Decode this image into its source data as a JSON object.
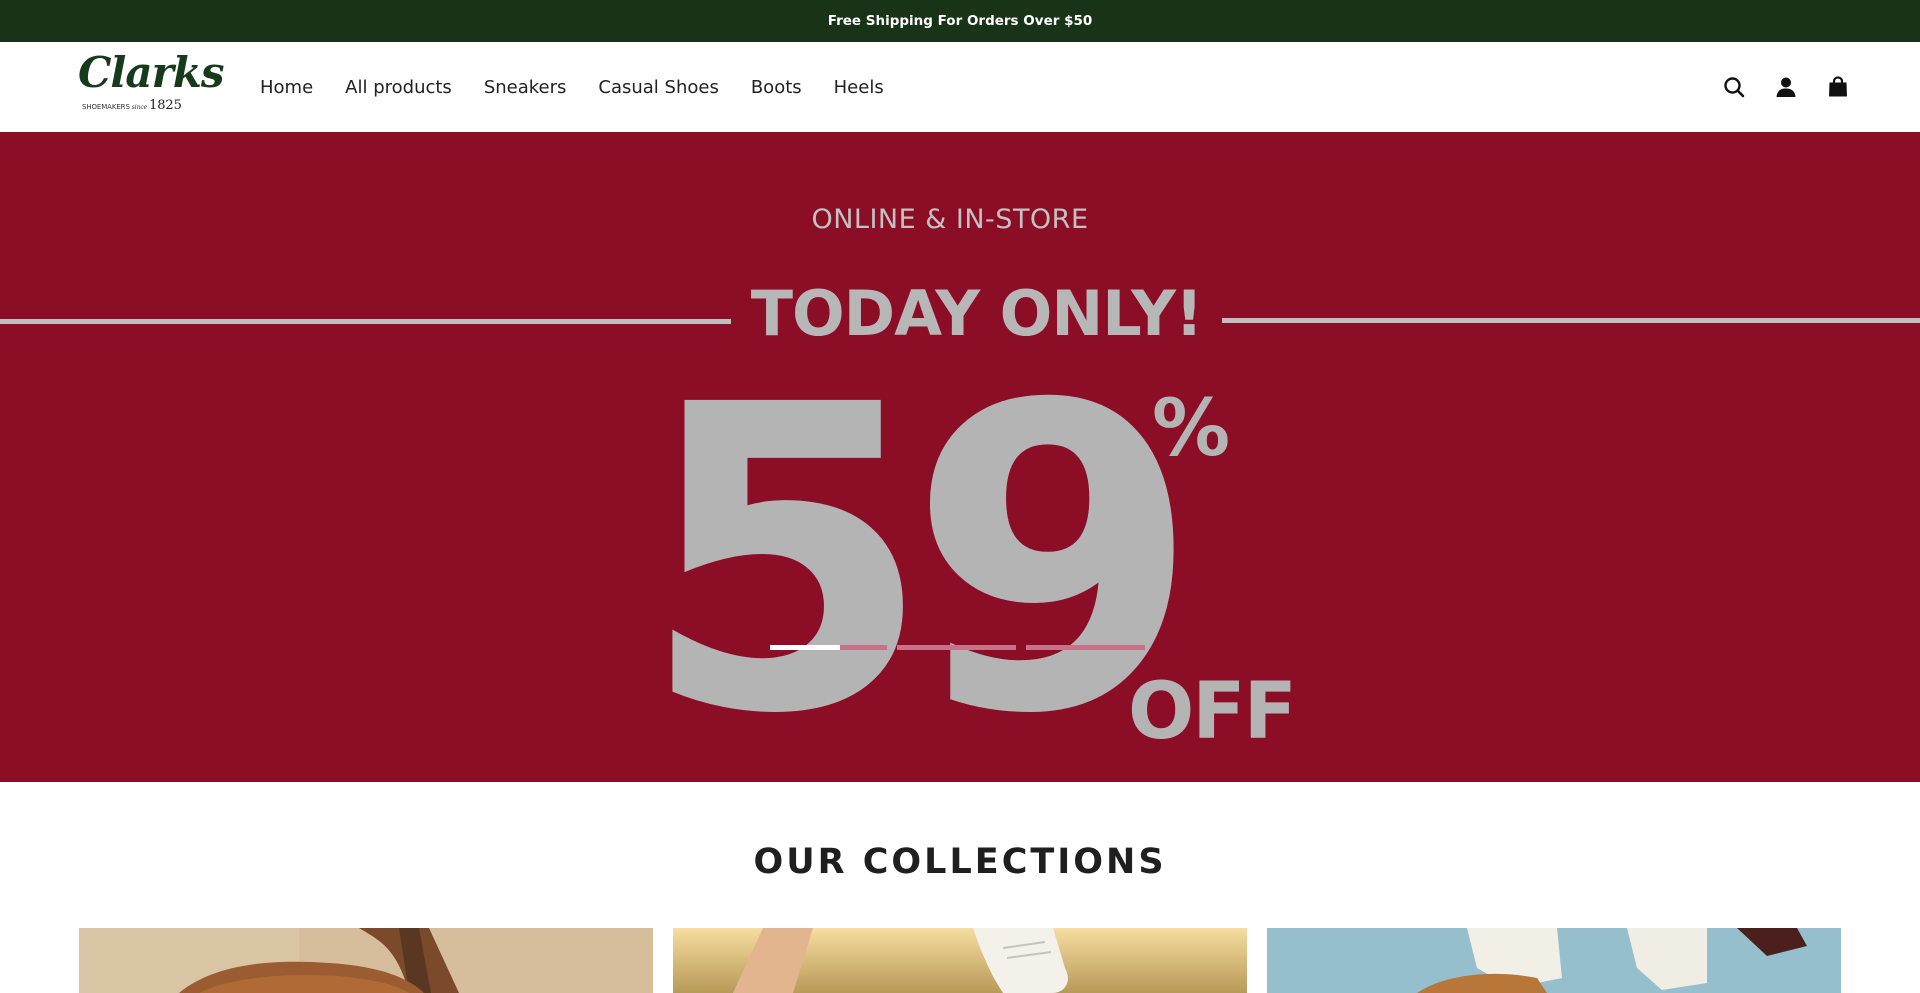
{
  "announcement": {
    "text": "Free Shipping For Orders Over $50"
  },
  "header": {
    "logo": {
      "wordmark": "Clarks",
      "tagline": "SHOEMAKERS",
      "since": "since",
      "year": "1825"
    },
    "nav": [
      {
        "label": "Home"
      },
      {
        "label": "All products"
      },
      {
        "label": "Sneakers"
      },
      {
        "label": "Casual Shoes"
      },
      {
        "label": "Boots"
      },
      {
        "label": "Heels"
      }
    ],
    "icons": [
      "search-icon",
      "account-icon",
      "cart-icon"
    ]
  },
  "hero": {
    "eyebrow": "ONLINE & IN-STORE",
    "headline": "TODAY ONLY!",
    "discount_number": "59",
    "percent": "%",
    "off": "OFF",
    "slide_count": 4,
    "active_slide": 1,
    "colors": {
      "background": "#8b0d26",
      "text": "#b4b4b4"
    }
  },
  "collections": {
    "title": "OUR COLLECTIONS"
  },
  "colors": {
    "announcement_bg": "#183318",
    "brand_green": "#183a1c"
  }
}
